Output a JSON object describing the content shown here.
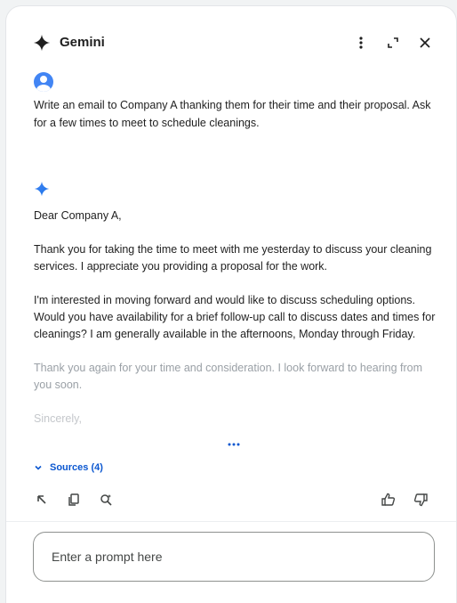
{
  "header": {
    "title": "Gemini",
    "more_icon": "more-vert-icon",
    "expand_icon": "expand-icon",
    "close_icon": "close-icon"
  },
  "conversation": {
    "user_message": "Write an email to Company A thanking them for their time and their proposal. Ask for a few times to meet to schedule cleanings.",
    "response": {
      "greeting": "Dear Company A,",
      "paragraph_1": "Thank you for taking the time to meet with me yesterday to discuss your cleaning services. I appreciate you providing a proposal for the work.",
      "paragraph_2": "I'm interested in moving forward and would like to discuss scheduling options. Would you have availability for a brief follow-up call to discuss dates and times for cleanings? I am generally available in the afternoons, Monday through Friday.",
      "paragraph_3": "Thank you again for your time and consideration. I look forward to hearing from you soon.",
      "closing": "Sincerely,"
    }
  },
  "sources": {
    "label": "Sources (4)"
  },
  "actions": {
    "left": [
      "insert-icon",
      "copy-icon",
      "search-refine-icon"
    ],
    "right": [
      "thumbs-up-icon",
      "thumbs-down-icon"
    ]
  },
  "input": {
    "placeholder": "Enter a prompt here",
    "value": ""
  },
  "colors": {
    "accent": "#0b57d0",
    "gemini_blue": "#4285f4",
    "text": "#1f1f1f",
    "faded_text": "#9aa0a6"
  }
}
